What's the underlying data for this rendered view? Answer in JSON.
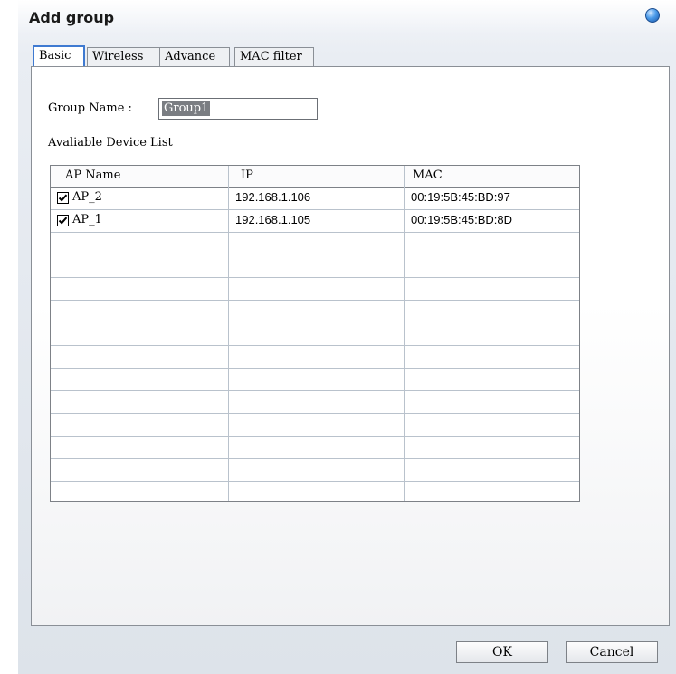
{
  "dialog": {
    "title": "Add group"
  },
  "tabs": [
    {
      "label": "Basic",
      "active": true
    },
    {
      "label": "Wireless",
      "active": false
    },
    {
      "label": "Advance",
      "active": false
    },
    {
      "label": "MAC filter",
      "active": false
    }
  ],
  "form": {
    "group_name_label": "Group Name :",
    "group_name_value": "Group1",
    "device_list_label": "Avaliable Device List"
  },
  "table": {
    "columns": [
      "AP Name",
      "IP",
      "MAC"
    ],
    "rows": [
      {
        "checked": true,
        "name": "AP_2",
        "ip": "192.168.1.106",
        "mac": "00:19:5B:45:BD:97"
      },
      {
        "checked": true,
        "name": "AP_1",
        "ip": "192.168.1.105",
        "mac": "00:19:5B:45:BD:8D"
      }
    ]
  },
  "buttons": {
    "ok": "OK",
    "cancel": "Cancel"
  },
  "colors": {
    "accent": "#3f7ad1",
    "orb": "#4b9bea"
  }
}
